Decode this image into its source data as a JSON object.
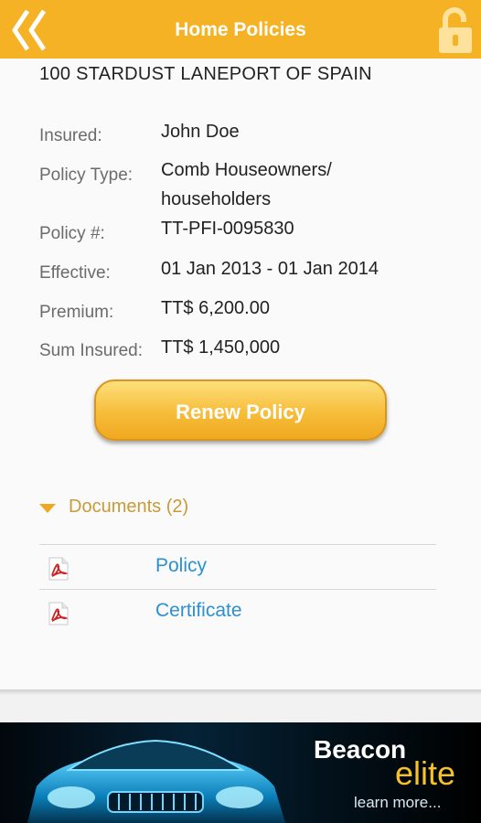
{
  "header": {
    "title": "Home Policies",
    "colors": {
      "bar": "#f5b225",
      "title": "#ffffff"
    },
    "icons": {
      "back": "double-chevron-left-icon",
      "lock": "unlocked-padlock-icon"
    }
  },
  "policy": {
    "address": "100 STARDUST LANEPORT OF SPAIN",
    "fields": [
      {
        "label": "Insured:",
        "value": "John Doe"
      },
      {
        "label": "Policy Type:",
        "value": "Comb Houseowners/",
        "value2": "householders"
      },
      {
        "label": "Policy #:",
        "value": "TT-PFI-0095830"
      },
      {
        "label": "Effective:",
        "value": "01 Jan 2013 - 01 Jan 2014"
      },
      {
        "label": "Premium:",
        "value": "TT$ 6,200.00"
      },
      {
        "label": "Sum Insured:",
        "value": "TT$ 1,450,000"
      }
    ]
  },
  "renew_button": {
    "label": "Renew Policy"
  },
  "documents": {
    "title": "Documents (2)",
    "items": [
      {
        "label": "Policy",
        "icon": "pdf-icon"
      },
      {
        "label": "Certificate",
        "icon": "pdf-icon"
      }
    ]
  },
  "ad": {
    "brand": "Beacon",
    "sub": "elite",
    "cta": "learn more..."
  }
}
